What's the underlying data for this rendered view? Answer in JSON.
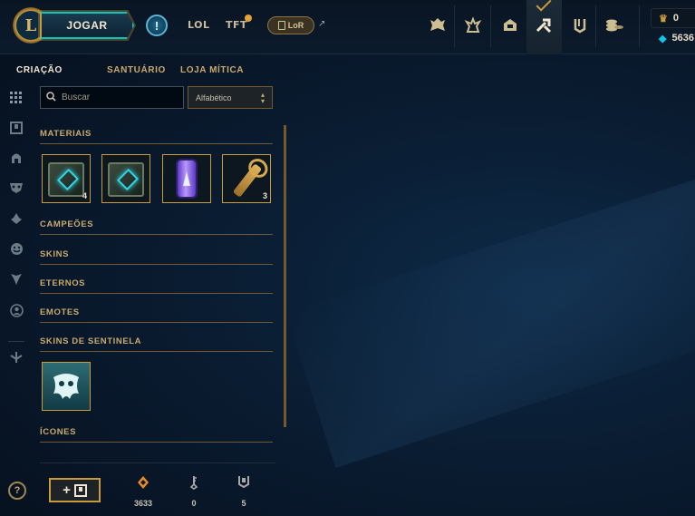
{
  "header": {
    "logo_letter": "L",
    "play_label": "JOGAR",
    "alert_label": "!",
    "nav": [
      "LOL",
      "TFT"
    ],
    "lor_label": "LoR",
    "lor_external": "↗",
    "icons": [
      "champions-icon",
      "loot-tab-icon",
      "store-icon",
      "crafting-icon",
      "collection-icon",
      "currency-icon"
    ],
    "currency": {
      "rp": "0",
      "blue_essence": "5636"
    }
  },
  "subnav": [
    "CRIAÇÃO",
    "SANTUÁRIO",
    "LOJA MÍTICA"
  ],
  "sidebar_icons": [
    "grid-icon",
    "chest-icon",
    "helmet-icon",
    "mask-icon",
    "ward-icon",
    "emote-icon",
    "eternals-icon",
    "profile-icon",
    "sentinel-icon"
  ],
  "help_label": "?",
  "search": {
    "placeholder": "Buscar"
  },
  "sort": {
    "selected": "Alfabético"
  },
  "sections": {
    "materials": "MATERIAIS",
    "champions": "CAMPEÕES",
    "skins": "SKINS",
    "eternals": "ETERNOS",
    "emotes": "EMOTES",
    "sentinel_skins": "SKINS DE SENTINELA",
    "icons": "ÍCONES"
  },
  "materials": [
    {
      "name": "hextech-chest",
      "count": "4"
    },
    {
      "name": "masterwork-chest",
      "count": ""
    },
    {
      "name": "capsule",
      "count": ""
    },
    {
      "name": "key-fragment",
      "count": "3"
    }
  ],
  "bottom": {
    "add_label": "+",
    "stats": [
      {
        "icon": "orange-essence-icon",
        "value": "3633"
      },
      {
        "icon": "key-icon",
        "value": "0"
      },
      {
        "icon": "chest-icon",
        "value": "5"
      }
    ]
  },
  "colors": {
    "gold": "#c89b3c",
    "teal": "#0ac8b9",
    "bg": "#0a1d33"
  }
}
